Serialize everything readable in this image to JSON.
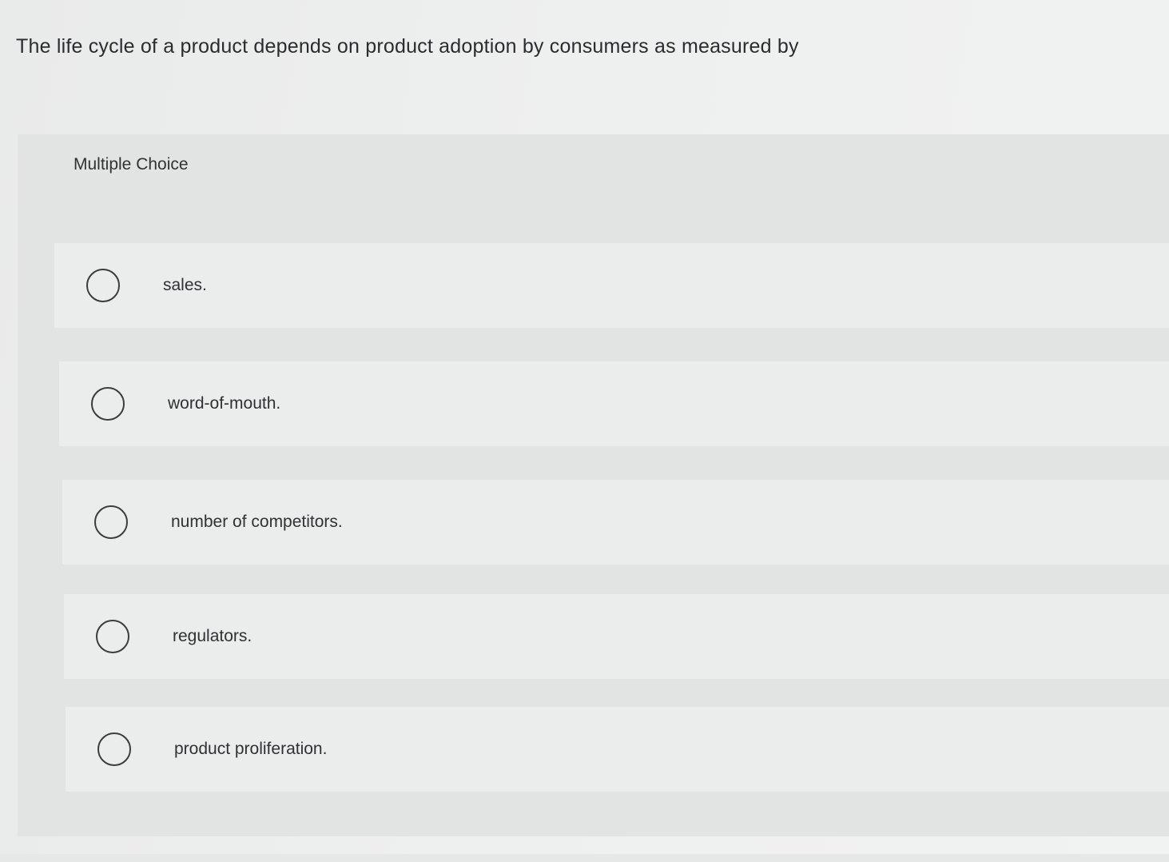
{
  "question": {
    "text": "The life cycle of a product depends on product adoption by consumers as measured by"
  },
  "panel": {
    "label": "Multiple Choice"
  },
  "options": [
    {
      "label": "sales.",
      "selected": false
    },
    {
      "label": "word-of-mouth.",
      "selected": false
    },
    {
      "label": "number of competitors.",
      "selected": false
    },
    {
      "label": "regulators.",
      "selected": false
    },
    {
      "label": "product proliferation.",
      "selected": false
    }
  ],
  "colors": {
    "background": "#eeefef",
    "panel": "#e2e3e3",
    "option": "#ebecec",
    "text": "#2b2d2f"
  }
}
